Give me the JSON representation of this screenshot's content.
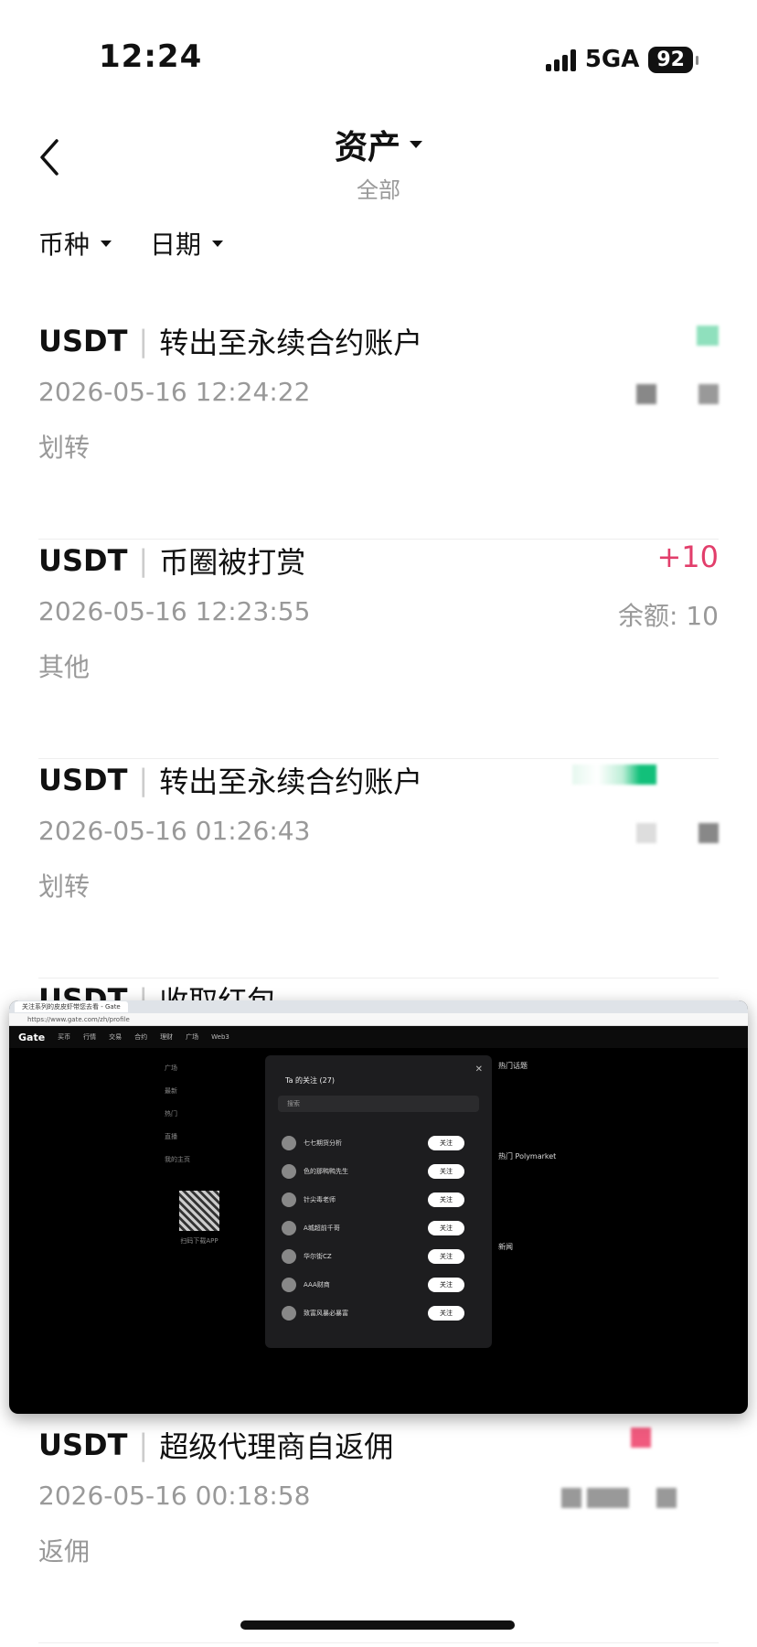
{
  "status_bar": {
    "time": "12:24",
    "network": "5GA",
    "battery": "92"
  },
  "header": {
    "title": "资产",
    "subtitle": "全部"
  },
  "filters": [
    {
      "label": "币种"
    },
    {
      "label": "日期"
    }
  ],
  "records": [
    {
      "coin": "USDT",
      "desc": "转出至永续合约账户",
      "time": "2026-05-16 12:24:22",
      "type": "划转",
      "amount": "",
      "balance": ""
    },
    {
      "coin": "USDT",
      "desc": "币圈被打赏",
      "time": "2026-05-16 12:23:55",
      "type": "其他",
      "amount": "+10",
      "balance": "余额: 10"
    },
    {
      "coin": "USDT",
      "desc": "转出至永续合约账户",
      "time": "2026-05-16 01:26:43",
      "type": "划转",
      "amount": "",
      "balance": ""
    },
    {
      "coin": "USDT",
      "desc": "收取红包",
      "time": "",
      "type": "",
      "amount": "",
      "balance": ""
    },
    {
      "coin": "USDT",
      "desc": "超级代理商自返佣",
      "time": "2026-05-16 00:18:58",
      "type": "返佣",
      "amount": "",
      "balance": ""
    }
  ],
  "overlay": {
    "browser_tab": "关注系列的皮皮虾带您去看 - Gate",
    "url": "https://www.gate.com/zh/profile",
    "logo": "Gate",
    "nav_items": [
      "买币",
      "行情",
      "交易",
      "合约",
      "理财",
      "广场",
      "Web3"
    ],
    "side_items": [
      "广场",
      "最新",
      "热门",
      "直播",
      "我的主页"
    ],
    "download_label": "扫码下载APP",
    "modal": {
      "title": "Ta 的关注 (27)",
      "search_placeholder": "搜索",
      "items": [
        {
          "name": "七七期货分析",
          "button": "关注"
        },
        {
          "name": "色的那鸭鸭先生",
          "button": "关注"
        },
        {
          "name": "针尖毒老师",
          "button": "关注"
        },
        {
          "name": "A城超前千哥",
          "button": "关注"
        },
        {
          "name": "华尔街CZ",
          "button": "关注"
        },
        {
          "name": "AAA财商",
          "button": "关注"
        },
        {
          "name": "致富风暴必暴富",
          "button": "关注"
        }
      ]
    },
    "right_panel": {
      "hot_topics": "热门话题",
      "polymarket": "热门 Polymarket",
      "news": "新闻"
    }
  }
}
